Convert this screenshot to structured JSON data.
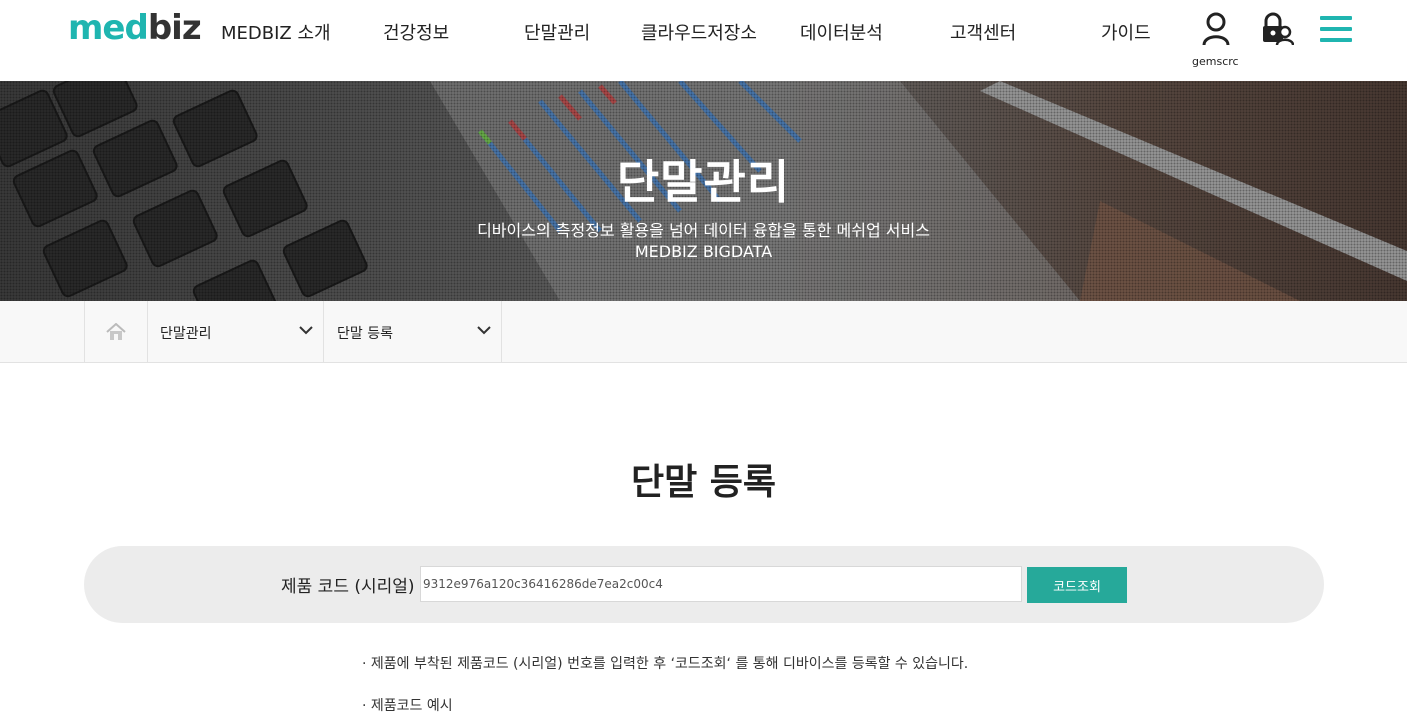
{
  "header": {
    "logo_part1": "med",
    "logo_part2": "biz",
    "nav": [
      "MEDBIZ 소개",
      "건강정보",
      "단말관리",
      "클라우드저장소",
      "데이터분석",
      "고객센터",
      "가이드"
    ],
    "username": "gemscrc",
    "icons": [
      "user-icon",
      "lock-icon",
      "hamburger-menu-icon"
    ]
  },
  "hero": {
    "title": "단말관리",
    "subtitle": "디바이스의 측정정보 활용을 넘어 데이터 융합을 통한 메쉬업 서비스",
    "subtitle2": "MEDBIZ BIGDATA"
  },
  "breadcrumb": {
    "home_icon": "home-icon",
    "level1": "단말관리",
    "level2": "단말 등록"
  },
  "main": {
    "title": "단말 등록",
    "code_label": "제품 코드 (시리얼)",
    "code_value": "9312e976a120c36416286de7ea2c00c4",
    "code_button": "코드조회",
    "notes": [
      "· 제품에 부착된 제품코드 (시리얼) 번호를 입력한 후 ‘코드조회‘ 를 통해 디바이스를 등록할 수 있습니다.",
      "· 제품코드 예시"
    ]
  },
  "colors": {
    "accent": "#1fb5b0",
    "button": "#26a99a"
  }
}
